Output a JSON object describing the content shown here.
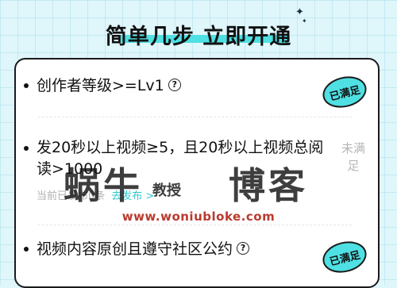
{
  "header": {
    "title": "简单几步 立即开通"
  },
  "requirements": [
    {
      "label": "创作者等级>=Lv1",
      "status": "已满足",
      "help_icon": "question-circle-icon"
    },
    {
      "label_line1": "发20秒以上视频≥5，且20秒以上视频总阅",
      "label_line2": "读>1000",
      "status_line1": "未满",
      "status_line2": "足",
      "sub_text": "当前已发布0条",
      "sub_link": "去发布 >"
    },
    {
      "label": "视频内容原创且遵守社区公约",
      "status": "已满足",
      "help_icon": "question-circle-icon"
    }
  ],
  "watermark": {
    "main": "蜗牛",
    "sub": "教授",
    "main2": "博客",
    "url": "www.woniubloke.com"
  },
  "colors": {
    "accent": "#4fe0e4",
    "link": "#34c8cf",
    "background": "#dff6fb"
  }
}
